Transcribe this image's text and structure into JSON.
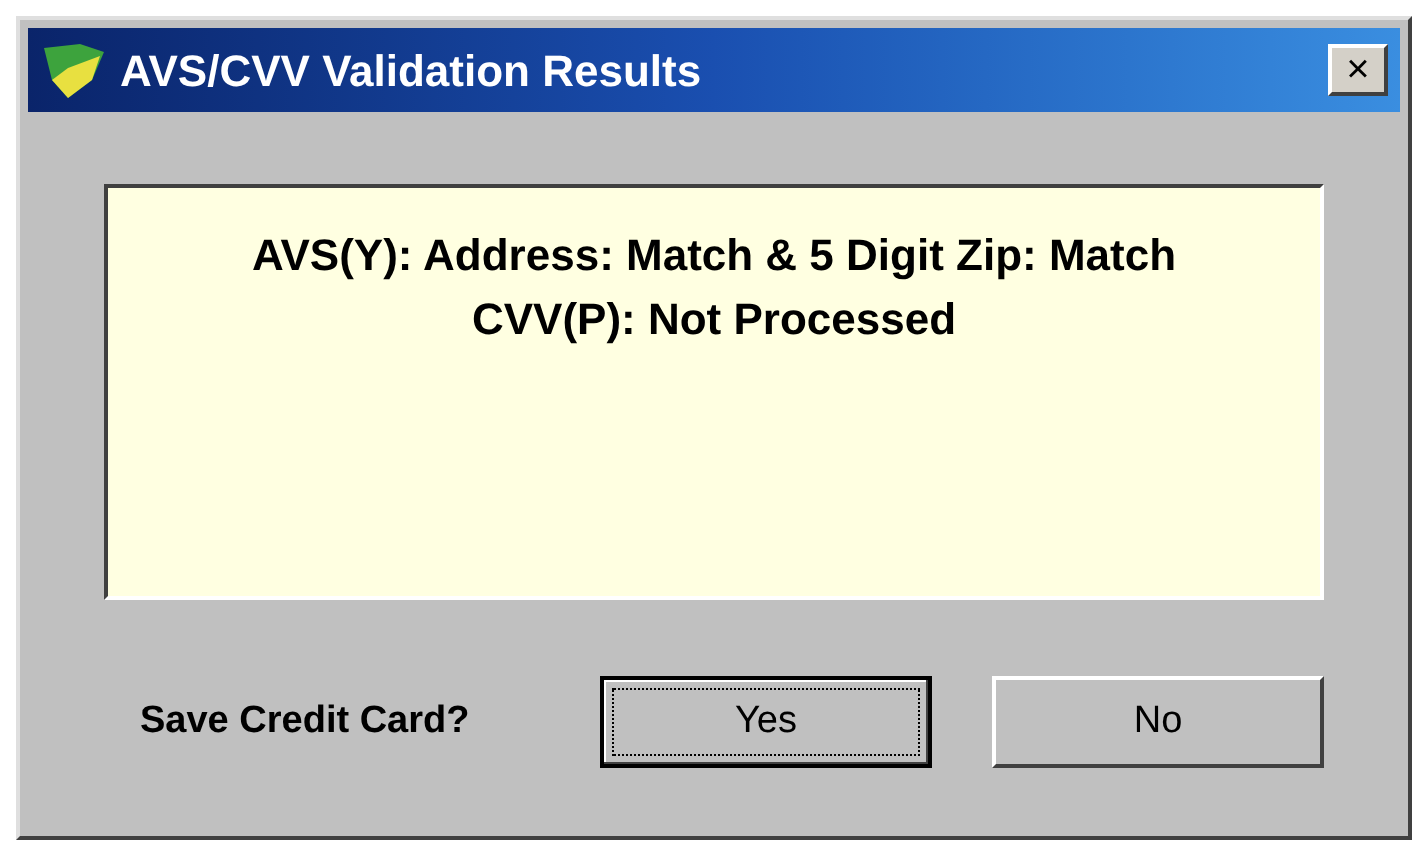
{
  "window": {
    "title": "AVS/CVV Validation Results",
    "close": "×"
  },
  "message": {
    "lines": [
      "AVS(Y): Address: Match & 5 Digit Zip: Match",
      "CVV(P): Not Processed"
    ]
  },
  "prompt": "Save Credit Card?",
  "buttons": [
    {
      "label": "Yes",
      "focused": true
    },
    {
      "label": "No",
      "focused": false
    }
  ]
}
